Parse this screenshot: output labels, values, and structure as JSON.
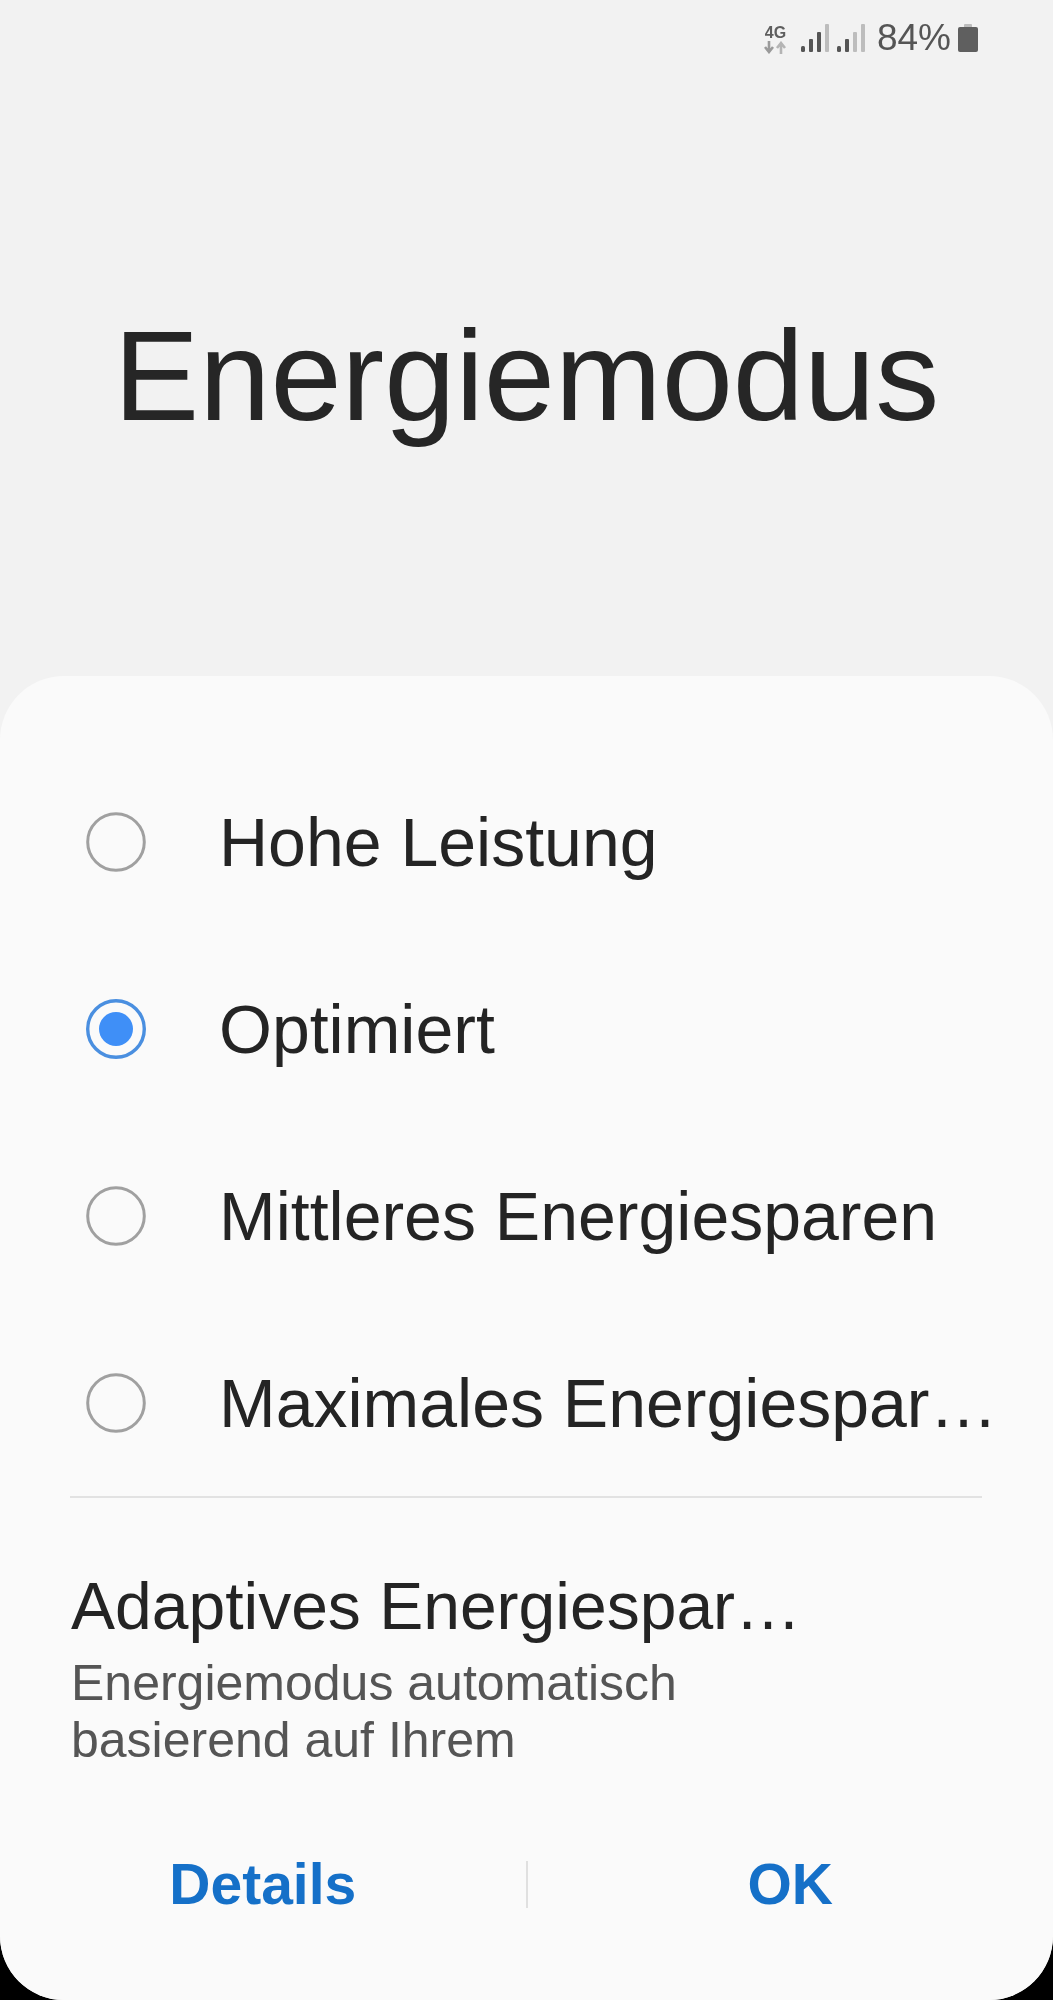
{
  "status_bar": {
    "network": "4G",
    "battery": "84%"
  },
  "title": "Energiemodus",
  "modes": [
    {
      "label": "Hohe Leistung",
      "selected": false
    },
    {
      "label": "Optimiert",
      "selected": true
    },
    {
      "label": "Mittleres Energiesparen",
      "selected": false
    },
    {
      "label": "Maximales Energiespar…",
      "selected": false
    }
  ],
  "adaptive": {
    "title": "Adaptives Energiespar…",
    "description": "Energiemodus automatisch basierend auf Ihrem"
  },
  "buttons": [
    "Details",
    "OK"
  ]
}
